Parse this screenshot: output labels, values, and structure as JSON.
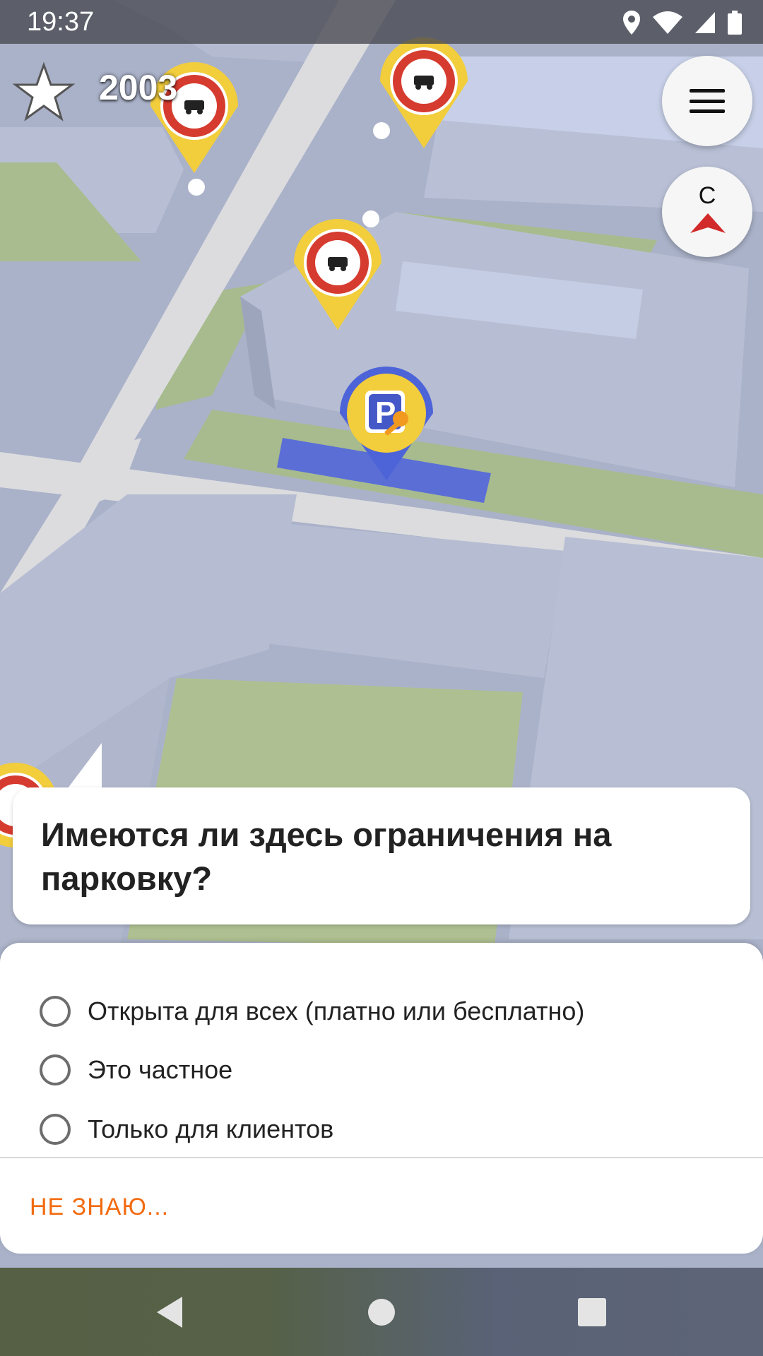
{
  "status_bar": {
    "time": "19:37",
    "icons": [
      "location-icon",
      "wifi-icon",
      "signal-icon",
      "battery-icon"
    ]
  },
  "top_left": {
    "star_icon": "star-icon",
    "counter": "2003"
  },
  "buttons": {
    "menu_icon": "hamburger-menu-icon",
    "compass_letter": "С",
    "compass_icon": "compass-needle-icon"
  },
  "map": {
    "markers": [
      "no-parking-sign-icon",
      "no-parking-sign-icon",
      "no-parking-sign-icon",
      "no-parking-sign-icon",
      "parking-key-icon"
    ],
    "colors": {
      "building": "#b3bad0",
      "road": "#d9d9dc",
      "grass": "#a7bb8e",
      "highlight": "#5b6ed6"
    }
  },
  "question": {
    "text": "Имеются ли здесь ограничения на парковку?"
  },
  "answers": {
    "options": [
      {
        "label": "Открыта для всех (платно или бесплатно)"
      },
      {
        "label": "Это частное"
      },
      {
        "label": "Только для клиентов"
      }
    ],
    "dont_know": "НЕ ЗНАЮ..."
  },
  "nav_bar": {
    "icons": [
      "back-icon",
      "home-icon",
      "recents-icon"
    ]
  },
  "colors": {
    "accent": "#f26b0f",
    "marker_yellow": "#f2cd3c",
    "marker_red": "#d63b2f",
    "marker_blue": "#4d63d8"
  }
}
